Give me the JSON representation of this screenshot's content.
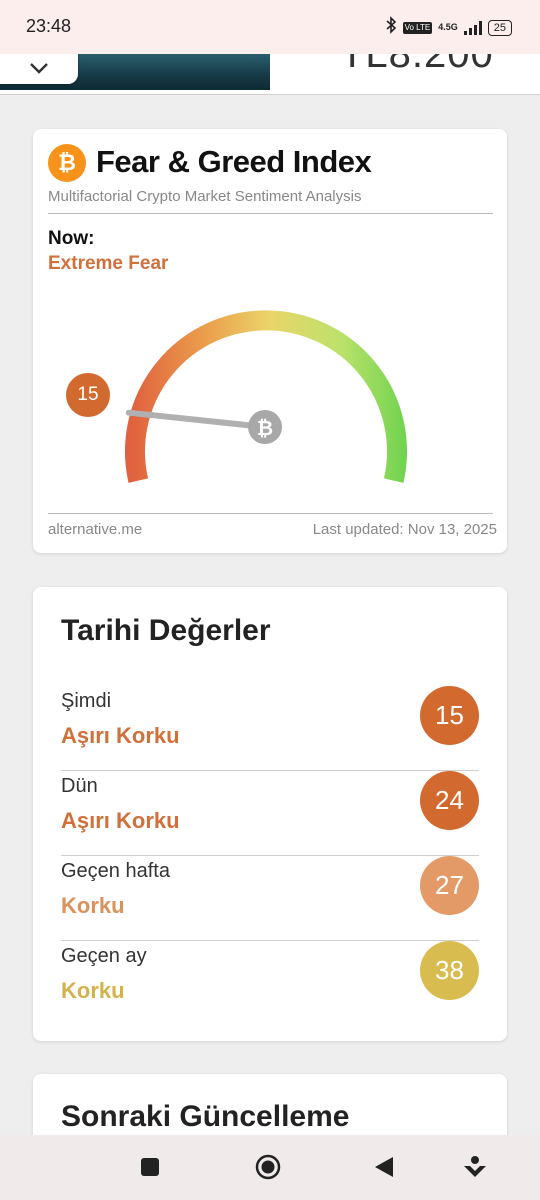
{
  "status_bar": {
    "time": "23:48",
    "volte": "Vo LTE",
    "network": "4.5G",
    "battery": "25"
  },
  "ad": {
    "price_text": "TL8.200"
  },
  "fear_greed": {
    "title": "Fear & Greed Index",
    "subtitle": "Multifactorial Crypto Market Sentiment Analysis",
    "now_label": "Now:",
    "classification": "Extreme Fear",
    "value": "15",
    "value_number": 15,
    "source": "alternative.me",
    "last_updated": "Last updated: Nov 13, 2025",
    "btc_symbol": "₿"
  },
  "history": {
    "title": "Tarihi Değerler",
    "rows": [
      {
        "label": "Şimdi",
        "classification": "Aşırı Korku",
        "value": "15",
        "color": "#d2692f",
        "text_color": "#d0703a"
      },
      {
        "label": "Dün",
        "classification": "Aşırı Korku",
        "value": "24",
        "color": "#d2692f",
        "text_color": "#d0703a"
      },
      {
        "label": "Geçen hafta",
        "classification": "Korku",
        "value": "27",
        "color": "#e39a67",
        "text_color": "#d9925c"
      },
      {
        "label": "Geçen ay",
        "classification": "Korku",
        "value": "38",
        "color": "#d8bc4f",
        "text_color": "#d2b34a"
      }
    ]
  },
  "next_update": {
    "title": "Sonraki Güncelleme"
  },
  "colors": {
    "extreme_fear": "#d2692f",
    "fear": "#e39a67",
    "neutral_fear": "#d8bc4f",
    "bitcoin": "#f7931a"
  },
  "icons": {
    "status": [
      "bluetooth-icon",
      "volte-icon",
      "signal-icon",
      "battery-icon"
    ],
    "nav": [
      "recents-square-icon",
      "home-circle-icon",
      "back-triangle-icon",
      "assistant-icon"
    ]
  }
}
